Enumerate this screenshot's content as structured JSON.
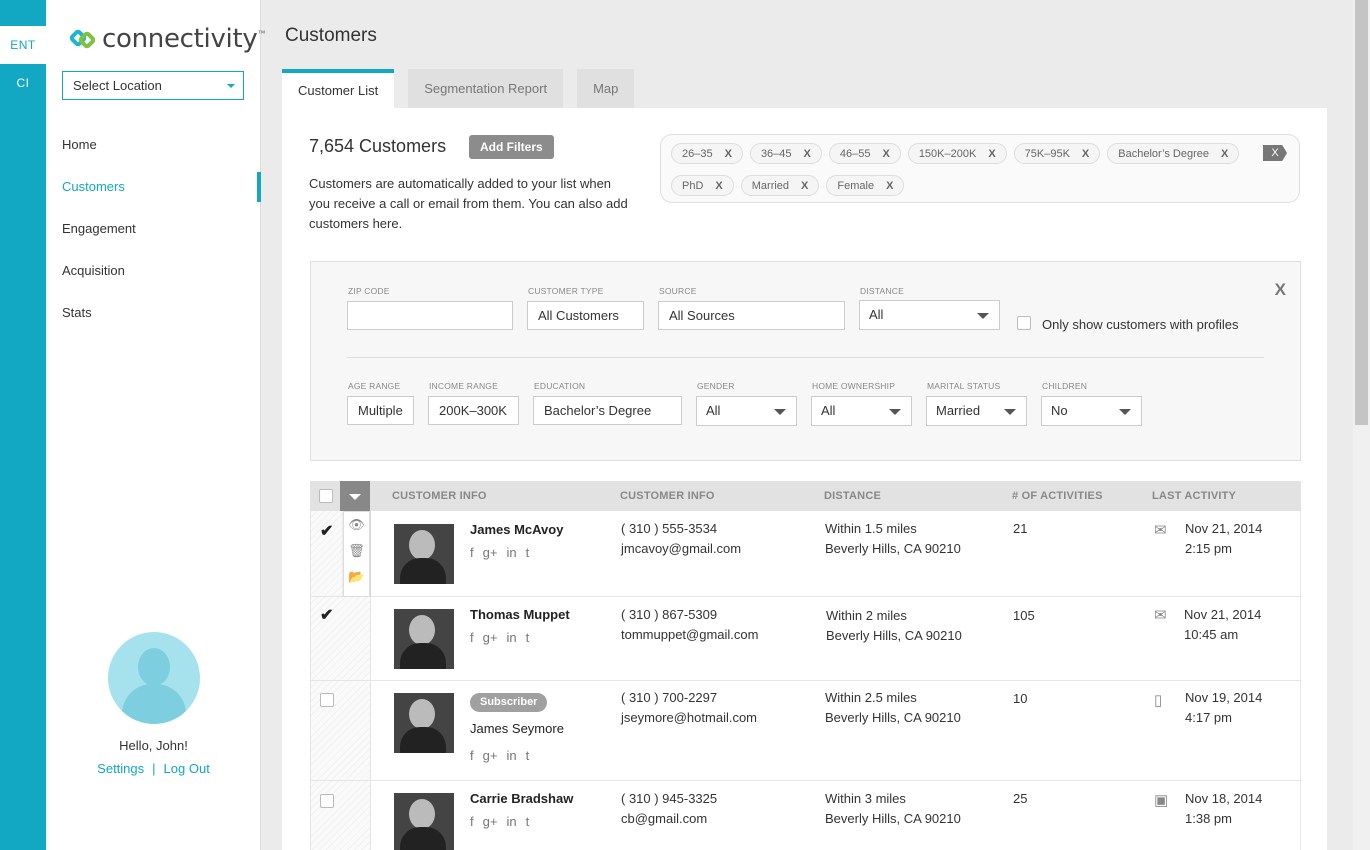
{
  "rail": {
    "items": [
      "ENT",
      "CI"
    ]
  },
  "brand": {
    "name": "connectivity",
    "tm": "™"
  },
  "location": {
    "label": "Select Location"
  },
  "nav": {
    "items": [
      "Home",
      "Customers",
      "Engagement",
      "Acquisition",
      "Stats"
    ],
    "active": "Customers"
  },
  "user": {
    "greeting": "Hello, John!",
    "settings": "Settings",
    "sep": "|",
    "logout": "Log Out"
  },
  "page": {
    "title": "Customers"
  },
  "tabs": [
    "Customer List",
    "Segmentation Report",
    "Map"
  ],
  "summary": {
    "count": "7,654 Customers",
    "add_filters": "Add Filters",
    "description": "Customers are automatically added to your list when you receive a call or email from them. You can also add customers here."
  },
  "chips": {
    "row1": [
      "26–35",
      "36–45",
      "46–55",
      "150K–200K",
      "75K–95K",
      "Bachelor’s Degree"
    ],
    "row2": [
      "PhD",
      "Married",
      "Female"
    ],
    "remove": "X"
  },
  "filters": {
    "close": "X",
    "zip": {
      "label": "ZIP CODE",
      "value": ""
    },
    "customer_type": {
      "label": "CUSTOMER TYPE",
      "value": "All Customers"
    },
    "source": {
      "label": "SOURCE",
      "value": "All Sources"
    },
    "distance": {
      "label": "DISTANCE",
      "value": "All"
    },
    "only_profiles": "Only show customers with profiles",
    "age": {
      "label": "AGE RANGE",
      "value": "Multiple"
    },
    "income": {
      "label": "INCOME RANGE",
      "value": "200K–300K"
    },
    "education": {
      "label": "EDUCATION",
      "value": "Bachelor’s Degree"
    },
    "gender": {
      "label": "GENDER",
      "value": "All"
    },
    "home": {
      "label": "HOME OWNERSHIP",
      "value": "All"
    },
    "marital": {
      "label": "MARITAL STATUS",
      "value": "Married"
    },
    "children": {
      "label": "CHILDREN",
      "value": "No"
    }
  },
  "table": {
    "headers": [
      "CUSTOMER INFO",
      "CUSTOMER INFO",
      "DISTANCE",
      "# OF ACTIVITIES",
      "LAST ACTIVITY"
    ],
    "rows": [
      {
        "name": "James McAvoy",
        "phone": "( 310 ) 555-3534",
        "email": "jmcavoy@gmail.com",
        "distance": "Within 1.5 miles",
        "city": "Beverly Hills, CA 90210",
        "activities": "21",
        "date": "Nov 21, 2014",
        "time": "2:15 pm",
        "activity_icon": "envelope-icon",
        "checked": true
      },
      {
        "name": "Thomas Muppet",
        "phone": "( 310 ) 867-5309",
        "email": "tommuppet@gmail.com",
        "distance": "Within 2 miles",
        "city": "Beverly Hills, CA 90210",
        "activities": "105",
        "date": "Nov 21, 2014",
        "time": "10:45 am",
        "activity_icon": "envelope-icon",
        "checked": true
      },
      {
        "name": "James Seymore",
        "badge": "Subscriber",
        "phone": "( 310 ) 700-2297",
        "email": "jseymore@hotmail.com",
        "distance": "Within 2.5 miles",
        "city": "Beverly Hills, CA 90210",
        "activities": "10",
        "date": "Nov 19, 2014",
        "time": "4:17 pm",
        "activity_icon": "phone-icon",
        "checked": false
      },
      {
        "name": "Carrie Bradshaw",
        "phone": "( 310 ) 945-3325",
        "email": "cb@gmail.com",
        "distance": "Within 3 miles",
        "city": "Beverly Hills, CA 90210",
        "activities": "25",
        "date": "Nov 18, 2014",
        "time": "1:38 pm",
        "activity_icon": "monitor-icon",
        "checked": false
      }
    ]
  },
  "colors": {
    "accent": "#12a7c2",
    "green": "#7dc241"
  }
}
